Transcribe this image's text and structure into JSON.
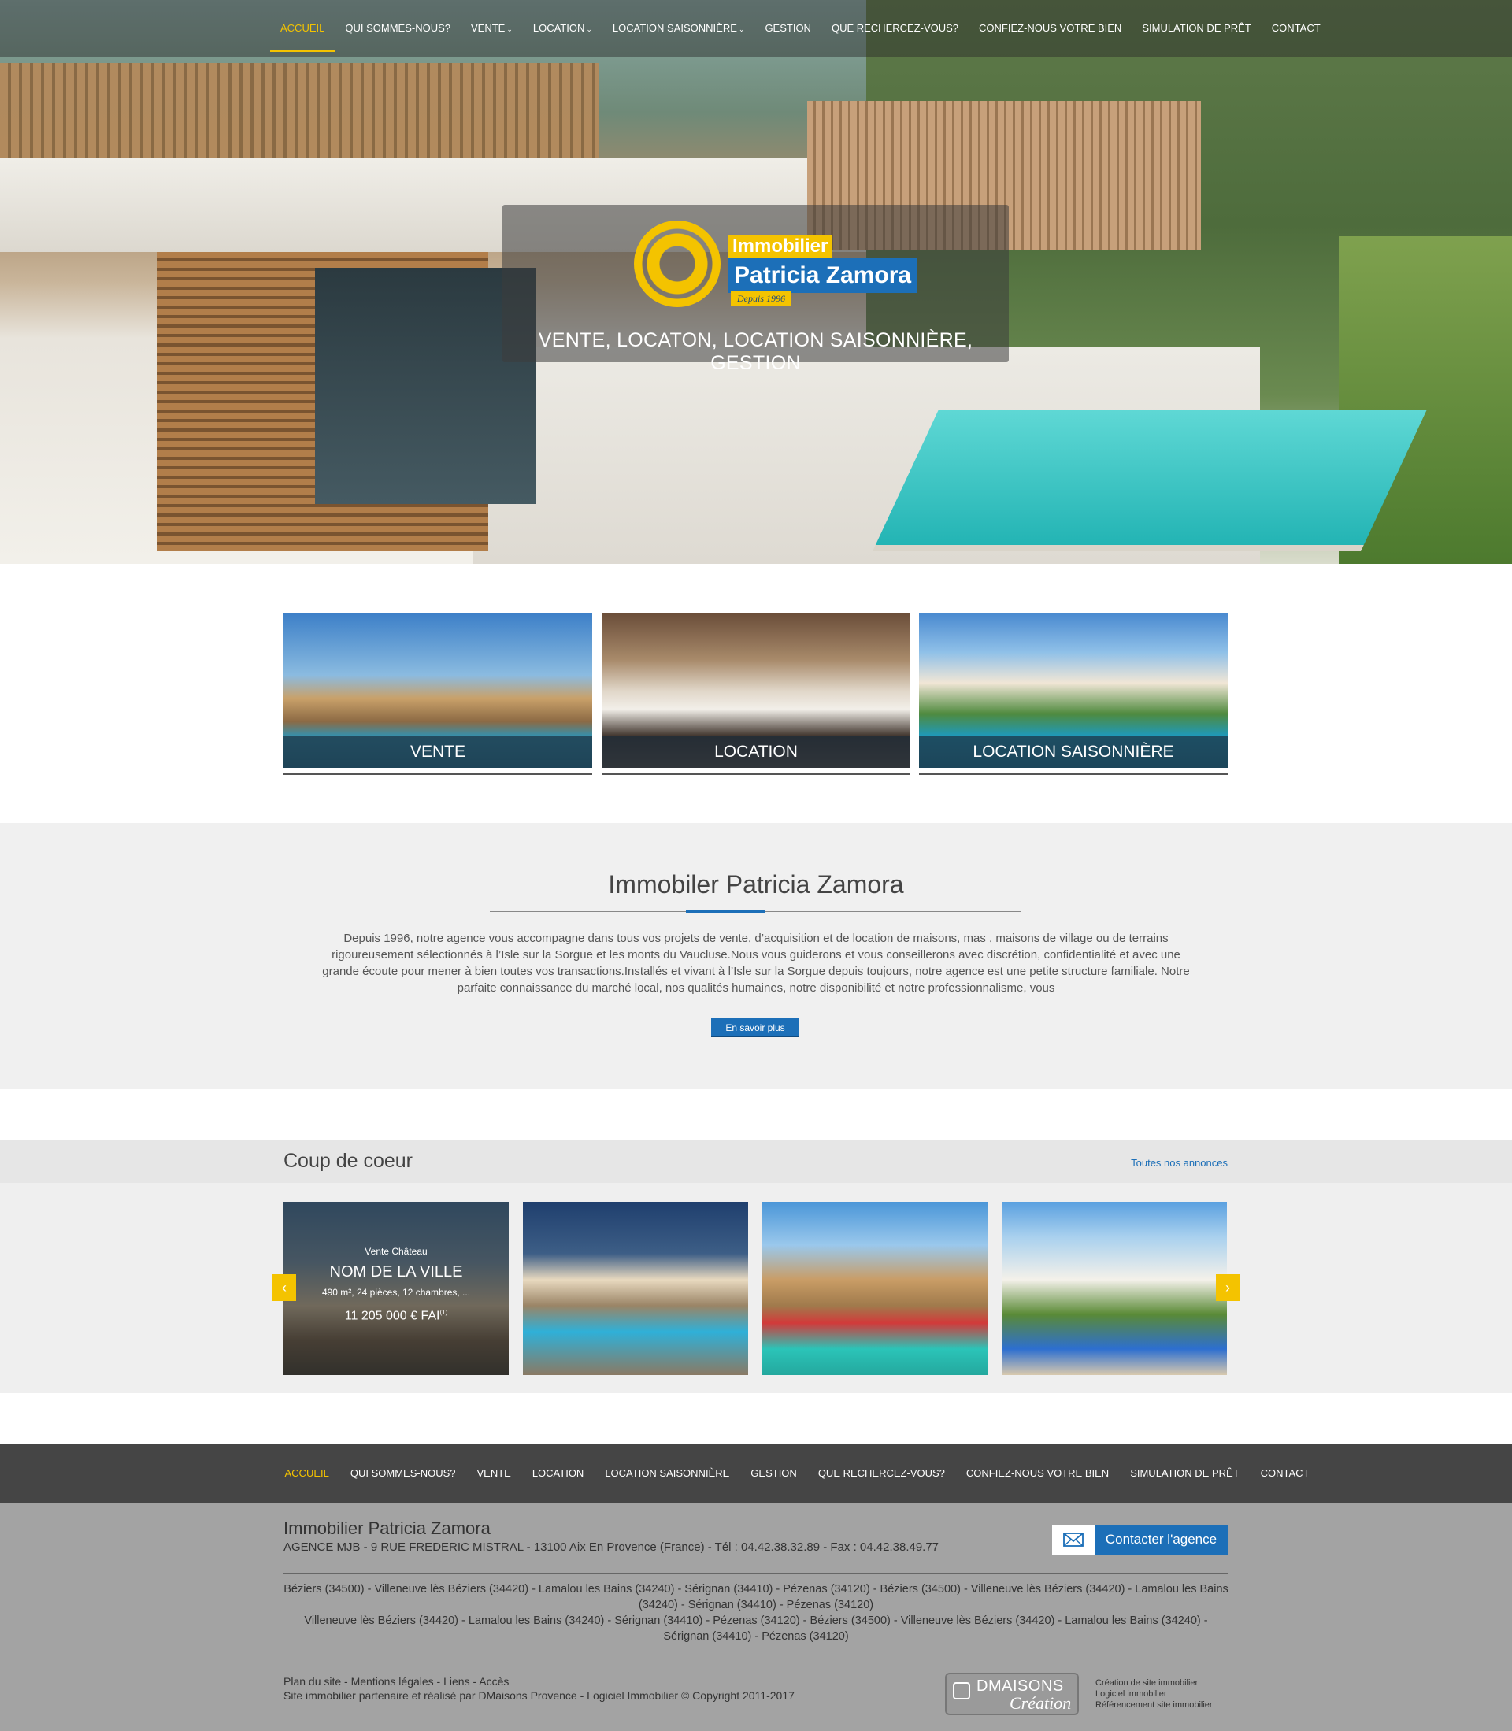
{
  "nav": {
    "items": [
      {
        "label": "ACCUEIL",
        "active": true
      },
      {
        "label": "QUI SOMMES-NOUS?"
      },
      {
        "label": "VENTE",
        "dropdown": true
      },
      {
        "label": "LOCATION",
        "dropdown": true
      },
      {
        "label": "LOCATION SAISONNIÈRE",
        "dropdown": true
      },
      {
        "label": "GESTION"
      },
      {
        "label": "QUE RECHERCEZ-VOUS?"
      },
      {
        "label": "CONFIEZ-NOUS VOTRE BIEN"
      },
      {
        "label": "SIMULATION DE PRÊT"
      },
      {
        "label": "CONTACT"
      }
    ]
  },
  "hero": {
    "logo_line1": "Immobilier",
    "logo_line2": "Patricia Zamora",
    "logo_line3": "Depuis 1996",
    "tagline": "VENTE, LOCATON, LOCATION SAISONNIÈRE, GESTION"
  },
  "categories": [
    {
      "label": "VENTE"
    },
    {
      "label": "LOCATION"
    },
    {
      "label": "LOCATION SAISONNIÈRE"
    }
  ],
  "about": {
    "title": "Immobiler Patricia Zamora",
    "text": "Depuis 1996, notre agence vous accompagne dans tous vos projets de vente, d’acquisition et de location de maisons, mas , maisons de village ou de terrains rigoureusement sélectionnés à l’Isle sur la Sorgue et les monts du Vaucluse.Nous vous guiderons et vous conseillerons avec discrétion, confidentialité et avec une grande écoute pour mener à bien toutes vos transactions.Installés et vivant à l’Isle sur la Sorgue depuis toujours, notre agence est une petite structure familiale. Notre parfaite connaissance du marché local, nos qualités humaines, notre disponibilité et notre professionnalisme, vous",
    "button": "En savoir plus"
  },
  "coup": {
    "title": "Coup de coeur",
    "all_link": "Toutes nos annonces",
    "card1": {
      "type": "Vente Château",
      "city": "NOM DE LA VILLE",
      "details": "490 m², 24 pièces, 12 chambres, ...",
      "price": "11 205 000 € FAI",
      "price_note": "(1)"
    },
    "prev_icon": "chevron-left",
    "next_icon": "chevron-right"
  },
  "footer_nav": {
    "items": [
      {
        "label": "ACCUEIL",
        "active": true
      },
      {
        "label": "QUI SOMMES-NOUS?"
      },
      {
        "label": "VENTE"
      },
      {
        "label": "LOCATION"
      },
      {
        "label": "LOCATION SAISONNIÈRE"
      },
      {
        "label": "GESTION"
      },
      {
        "label": "QUE RECHERCEZ-VOUS?"
      },
      {
        "label": "CONFIEZ-NOUS VOTRE BIEN"
      },
      {
        "label": "SIMULATION DE PRÊT"
      },
      {
        "label": "CONTACT"
      }
    ]
  },
  "footer": {
    "title": "Immobilier Patricia Zamora",
    "address": "AGENCE MJB - 9 RUE FREDERIC MISTRAL - 13100 Aix En Provence (France) - Tél : 04.42.38.32.89 - Fax : 04.42.38.49.77",
    "contact_button": "Contacter l'agence",
    "cities_1": "Béziers (34500) - Villeneuve lès Béziers (34420) - Lamalou les Bains (34240) - Sérignan (34410) - Pézenas (34120) - Béziers (34500) - Villeneuve lès Béziers (34420) - Lamalou les Bains (34240) - Sérignan (34410) - Pézenas (34120)",
    "cities_2": "Villeneuve lès Béziers (34420) - Lamalou les Bains (34240) - Sérignan (34410) - Pézenas (34120) - Béziers (34500) - Villeneuve lès Béziers (34420) - Lamalou les Bains (34240) - Sérignan (34410) - Pézenas (34120)",
    "links": "Plan du site - Mentions légales - Liens - Accès",
    "credit": "Site immobilier partenaire et réalisé par DMaisons Provence - Logiciel Immobilier © Copyright 2011-2017",
    "dm_logo_1": "DMAISONS",
    "dm_logo_2": "Création",
    "side_1": "Création de site immobilier",
    "side_2": "Logiciel immobilier",
    "side_3": "Référencement site immobilier"
  },
  "colors": {
    "accent": "#f4c300",
    "brand": "#1c6fb8"
  }
}
